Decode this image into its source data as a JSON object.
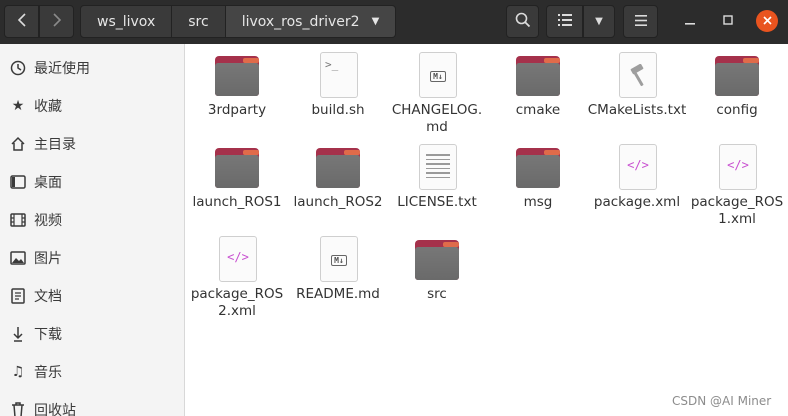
{
  "header": {
    "nav": {
      "back_icon": "chevron-left-icon",
      "forward_icon": "chevron-right-icon"
    },
    "breadcrumbs": [
      "ws_livox",
      "src",
      "livox_ros_driver2"
    ],
    "breadcrumb_dropdown_icon": "caret-down-icon",
    "search_icon": "search-icon",
    "view_icon": "list-view-icon",
    "view_dropdown_icon": "caret-down-icon",
    "menu_icon": "hamburger-menu-icon",
    "window_controls": [
      "minimize-icon",
      "maximize-icon",
      "close-icon"
    ]
  },
  "sidebar": {
    "items": [
      {
        "label": "最近使用",
        "icon": "clock-icon"
      },
      {
        "label": "收藏",
        "icon": "star-icon"
      },
      {
        "label": "主目录",
        "icon": "home-icon"
      },
      {
        "label": "桌面",
        "icon": "desktop-icon"
      },
      {
        "label": "视频",
        "icon": "video-icon"
      },
      {
        "label": "图片",
        "icon": "image-icon"
      },
      {
        "label": "文档",
        "icon": "document-icon"
      },
      {
        "label": "下载",
        "icon": "download-icon"
      },
      {
        "label": "音乐",
        "icon": "music-icon"
      },
      {
        "label": "回收站",
        "icon": "trash-icon"
      }
    ]
  },
  "files": [
    {
      "name": "3rdparty",
      "type": "folder"
    },
    {
      "name": "build.sh",
      "type": "script"
    },
    {
      "name": "CHANGELOG.md",
      "type": "markdown"
    },
    {
      "name": "cmake",
      "type": "folder"
    },
    {
      "name": "CMakeLists.txt",
      "type": "cmake"
    },
    {
      "name": "config",
      "type": "folder"
    },
    {
      "name": "launch_ROS1",
      "type": "folder"
    },
    {
      "name": "launch_ROS2",
      "type": "folder"
    },
    {
      "name": "LICENSE.txt",
      "type": "text"
    },
    {
      "name": "msg",
      "type": "folder"
    },
    {
      "name": "package.xml",
      "type": "xml"
    },
    {
      "name": "package_ROS1.xml",
      "type": "xml"
    },
    {
      "name": "package_ROS2.xml",
      "type": "xml"
    },
    {
      "name": "README.md",
      "type": "markdown"
    },
    {
      "name": "src",
      "type": "folder"
    }
  ],
  "watermark": "CSDN @AI Miner",
  "colors": {
    "header_bg": "#2c2c2c",
    "folder_red": "#a5314b",
    "folder_gray": "#6e6e6e",
    "close_orange": "#e9541f",
    "xml_purple": "#c84fd0"
  }
}
